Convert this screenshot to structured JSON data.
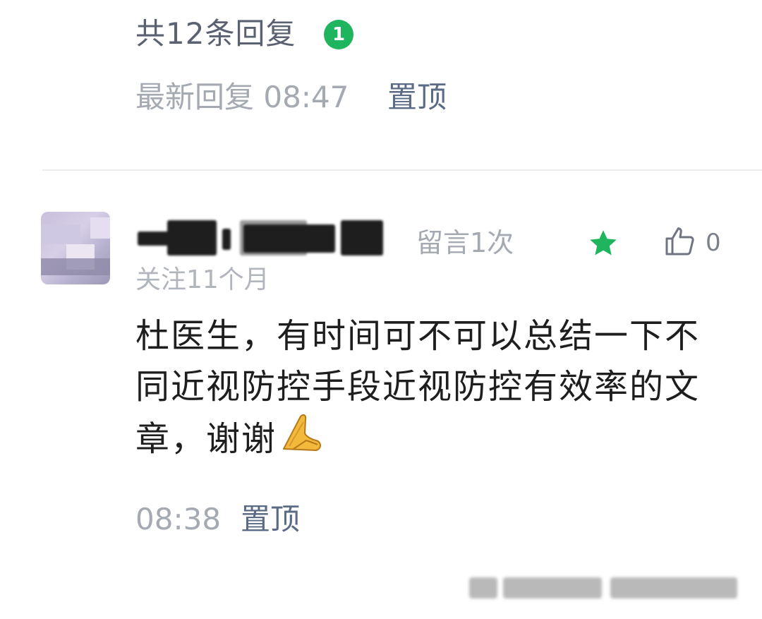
{
  "reply_summary": {
    "count_text": "共12条回复",
    "badge": "1",
    "latest_label": "最新回复 08:47",
    "pin_label": "置顶"
  },
  "comment": {
    "author_visible_count": "留言1次",
    "like_count": "0",
    "follow_duration": "关注11个月",
    "text": "杜医生，有时间可不可以总结一下不同近视防控手段近视防控有效率的文章，谢谢",
    "emoji": "folded-hands-icon",
    "time": "08:38",
    "pin_label": "置顶"
  },
  "colors": {
    "badge_green": "#1fb55e",
    "star_green": "#1fb55e",
    "link_blue_gray": "#5b6a85",
    "muted_gray": "#a4a9b2",
    "text_dark": "#1e1e1e"
  }
}
